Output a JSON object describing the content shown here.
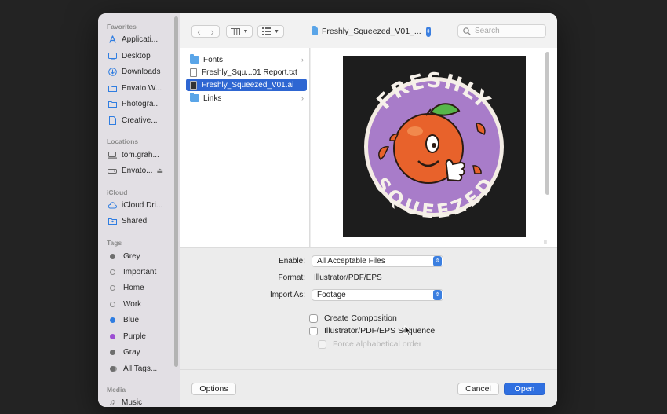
{
  "sidebar": {
    "favorites_title": "Favorites",
    "favorites": [
      {
        "label": "Applicati...",
        "icon": "applications-icon"
      },
      {
        "label": "Desktop",
        "icon": "desktop-icon"
      },
      {
        "label": "Downloads",
        "icon": "downloads-icon"
      },
      {
        "label": "Envato W...",
        "icon": "folder-icon"
      },
      {
        "label": "Photogra...",
        "icon": "folder-icon"
      },
      {
        "label": "Creative...",
        "icon": "document-icon"
      }
    ],
    "locations_title": "Locations",
    "locations": [
      {
        "label": "tom.grah...",
        "icon": "laptop-icon"
      },
      {
        "label": "Envato...",
        "icon": "drive-icon",
        "eject": "⏏"
      }
    ],
    "icloud_title": "iCloud",
    "icloud": [
      {
        "label": "iCloud Dri...",
        "icon": "cloud-icon"
      },
      {
        "label": "Shared",
        "icon": "shared-folder-icon"
      }
    ],
    "tags_title": "Tags",
    "tags": [
      {
        "label": "Grey",
        "color": "#6e6e6e",
        "style": "filled"
      },
      {
        "label": "Important",
        "color": "#8a8a8a",
        "style": "ring"
      },
      {
        "label": "Home",
        "color": "#8a8a8a",
        "style": "ring"
      },
      {
        "label": "Work",
        "color": "#8a8a8a",
        "style": "ring"
      },
      {
        "label": "Blue",
        "color": "#2f7de1",
        "style": "filled"
      },
      {
        "label": "Purple",
        "color": "#9c4fd3",
        "style": "filled"
      },
      {
        "label": "Gray",
        "color": "#6e6e6e",
        "style": "filled"
      },
      {
        "label": "All Tags...",
        "color": "#6e6e6e",
        "style": "multi"
      }
    ],
    "media_title": "Media",
    "media": [
      {
        "label": "Music",
        "icon": "music-icon"
      }
    ]
  },
  "toolbar": {
    "back": "‹",
    "forward": "›",
    "view_columns": "columns-view",
    "view_grid": "grid-view",
    "path_label": "Freshly_Squeezed_V01_...",
    "search_placeholder": "Search"
  },
  "files": [
    {
      "label": "Fonts",
      "type": "folder",
      "has_children": true
    },
    {
      "label": "Freshly_Squ...01 Report.txt",
      "type": "text",
      "has_children": false
    },
    {
      "label": "Freshly_Squeezed_V01.ai",
      "type": "illustrator",
      "has_children": false,
      "selected": true
    },
    {
      "label": "Links",
      "type": "folder",
      "has_children": true
    }
  ],
  "preview": {
    "logo_text_top": "FRESHLY",
    "logo_text_bottom": "SQUEEZED"
  },
  "options": {
    "enable_label": "Enable:",
    "enable_value": "All Acceptable Files",
    "format_label": "Format:",
    "format_value": "Illustrator/PDF/EPS",
    "import_as_label": "Import As:",
    "import_as_value": "Footage",
    "create_composition": "Create Composition",
    "sequence": "Illustrator/PDF/EPS Sequence",
    "force_alpha": "Force alphabetical order"
  },
  "buttons": {
    "options": "Options",
    "cancel": "Cancel",
    "open": "Open"
  },
  "colors": {
    "accent": "#2e66d2",
    "primary_button": "#2f6fe0",
    "preview_bg": "#1d1d1d",
    "logo_purple": "#a87cc9",
    "logo_orange": "#e8622b"
  }
}
